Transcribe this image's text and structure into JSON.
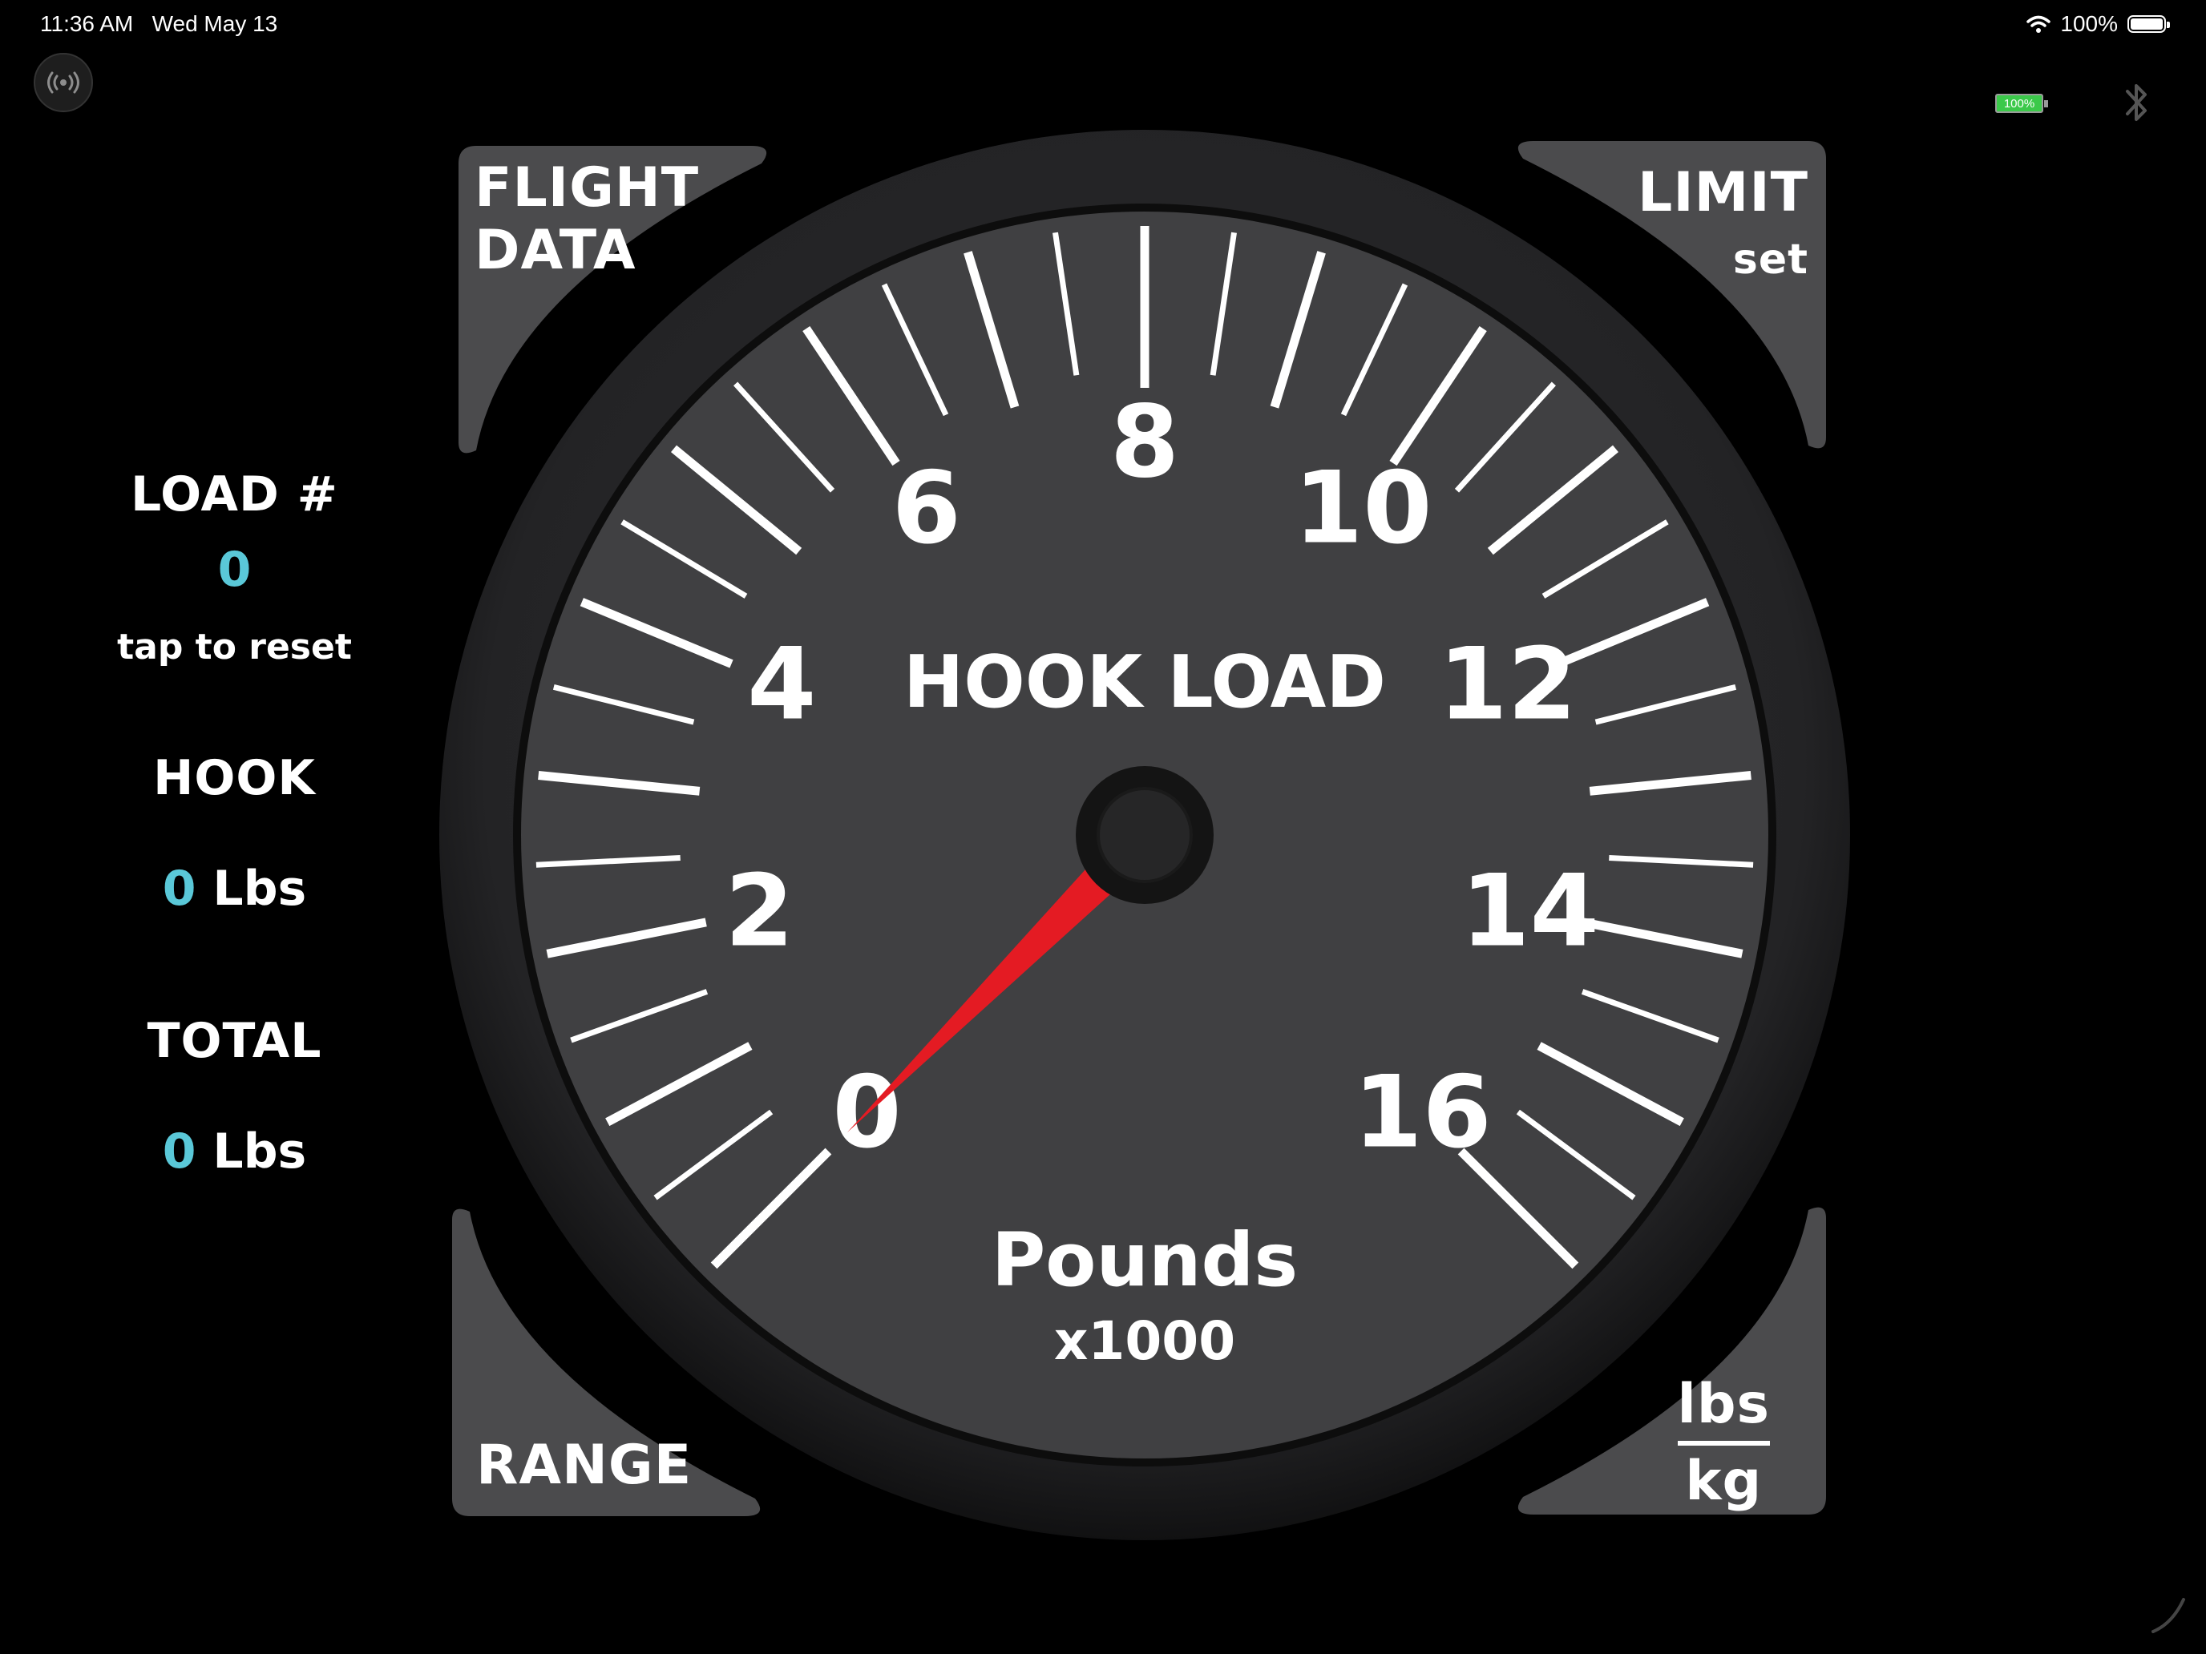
{
  "status_bar": {
    "time": "11:36 AM",
    "date": "Wed May 13",
    "battery_percent": "100%",
    "wifi_icon": "wifi-icon",
    "battery_icon": "battery-icon"
  },
  "top_bar": {
    "broadcast_icon": "broadcast-icon",
    "device_battery": "100%",
    "bluetooth_icon": "bluetooth-icon",
    "device_battery_color": "#3bc94a"
  },
  "left_panel": {
    "load_title": "LOAD #",
    "load_value": "0",
    "reset_hint": "tap to reset",
    "hook_title": "HOOK",
    "hook_value": "0",
    "hook_unit": "Lbs",
    "total_title": "TOTAL",
    "total_value": "0",
    "total_unit": "Lbs",
    "value_color": "#5ac8d8"
  },
  "corners": {
    "flight_data_line1": "FLIGHT",
    "flight_data_line2": "DATA",
    "limit_line1": "LIMIT",
    "limit_line2": "set",
    "range": "RANGE",
    "units_top": "lbs",
    "units_bottom": "kg"
  },
  "gauge": {
    "title": "HOOK LOAD",
    "unit_label": "Pounds",
    "multiplier": "x1000",
    "scale_labels": [
      "0",
      "2",
      "4",
      "6",
      "8",
      "10",
      "12",
      "14",
      "16"
    ],
    "min": 0,
    "max": 16,
    "value": 0,
    "needle_color": "#e41b23",
    "face_color": "#404042",
    "bezel_color": "#232325"
  }
}
